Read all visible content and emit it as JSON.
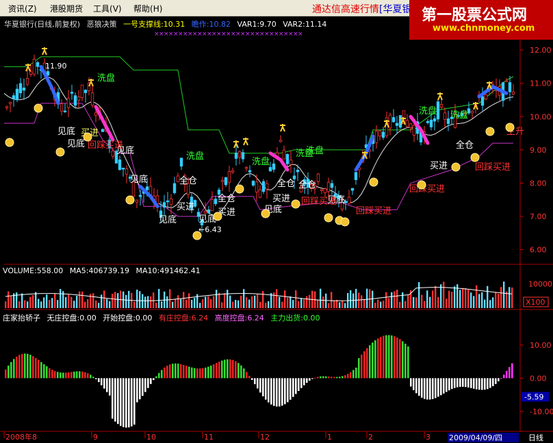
{
  "menu": {
    "items": [
      "资讯",
      "港股期货",
      "工具",
      "帮助"
    ],
    "shortcuts": [
      "(Z)",
      "",
      "(V)",
      "(H)"
    ]
  },
  "ticker": {
    "text": "通达信高速行情",
    "text_blue": "[华夏银"
  },
  "watermark": {
    "title": "第一股票公式网",
    "url": "www.chnmoney.com"
  },
  "main_panel": {
    "title": "华夏银行(日线,前复权)",
    "indicator": "恶狼决策",
    "support_label": "一号支撑线:10.31",
    "fade_label": "瞻作:10.82",
    "var1": "VAR1:9.70",
    "var2": "VAR2:11.14"
  },
  "volume_panel": {
    "label": "VOLUME:558.00",
    "ma5": "MA5:406739.19",
    "ma10": "MA10:491462.41"
  },
  "indicator_panel": {
    "title": "庄家抬轿子",
    "none": "无庄控盘:0.00",
    "start": "开始控盘:0.00",
    "has": "有庄控盘:6.24",
    "high": "高度控盘:6.24",
    "out": "主力出货:0.00"
  },
  "status": {
    "period": "日线",
    "date": "2009/04/09/四"
  },
  "colors": {
    "up": "#ff3333",
    "down": "#33ccff",
    "text_cyan": "#66ccff"
  },
  "chart_data": [
    {
      "type": "candlestick",
      "y_ticks": [
        "12.00",
        "11.00",
        "10.00",
        "9.00",
        "8.00",
        "7.00",
        "6.00"
      ],
      "ylim": [
        5.6,
        12.6
      ],
      "annotations": [
        "11.90",
        "6.43"
      ],
      "labels": [
        "洗盘",
        "洗盘",
        "洗盘",
        "洗盘",
        "洗盘",
        "洗盘",
        "洗盘",
        "见底",
        "见底",
        "见底",
        "见底",
        "见底",
        "见底",
        "见底",
        "见底",
        "买进",
        "买进",
        "买进",
        "买进",
        "买进",
        "全仓",
        "全仓",
        "全仓",
        "全仓",
        "全仓",
        "回踩买进",
        "回踩买进",
        "回踩买进",
        "回踩买进",
        "回踩买进",
        "主升"
      ]
    },
    {
      "type": "bar",
      "y_ticks": [
        "10000",
        "X100"
      ],
      "ylim": [
        0,
        14000
      ]
    },
    {
      "type": "bar",
      "y_ticks": [
        "10.00",
        "0.00",
        "-10.00"
      ],
      "current_value_label": "-5.59",
      "ylim": [
        -15,
        17
      ]
    },
    {
      "type": "axis",
      "x_labels": [
        "2008年8",
        "9",
        "10",
        "11",
        "12",
        "1",
        "2",
        "3"
      ]
    }
  ]
}
